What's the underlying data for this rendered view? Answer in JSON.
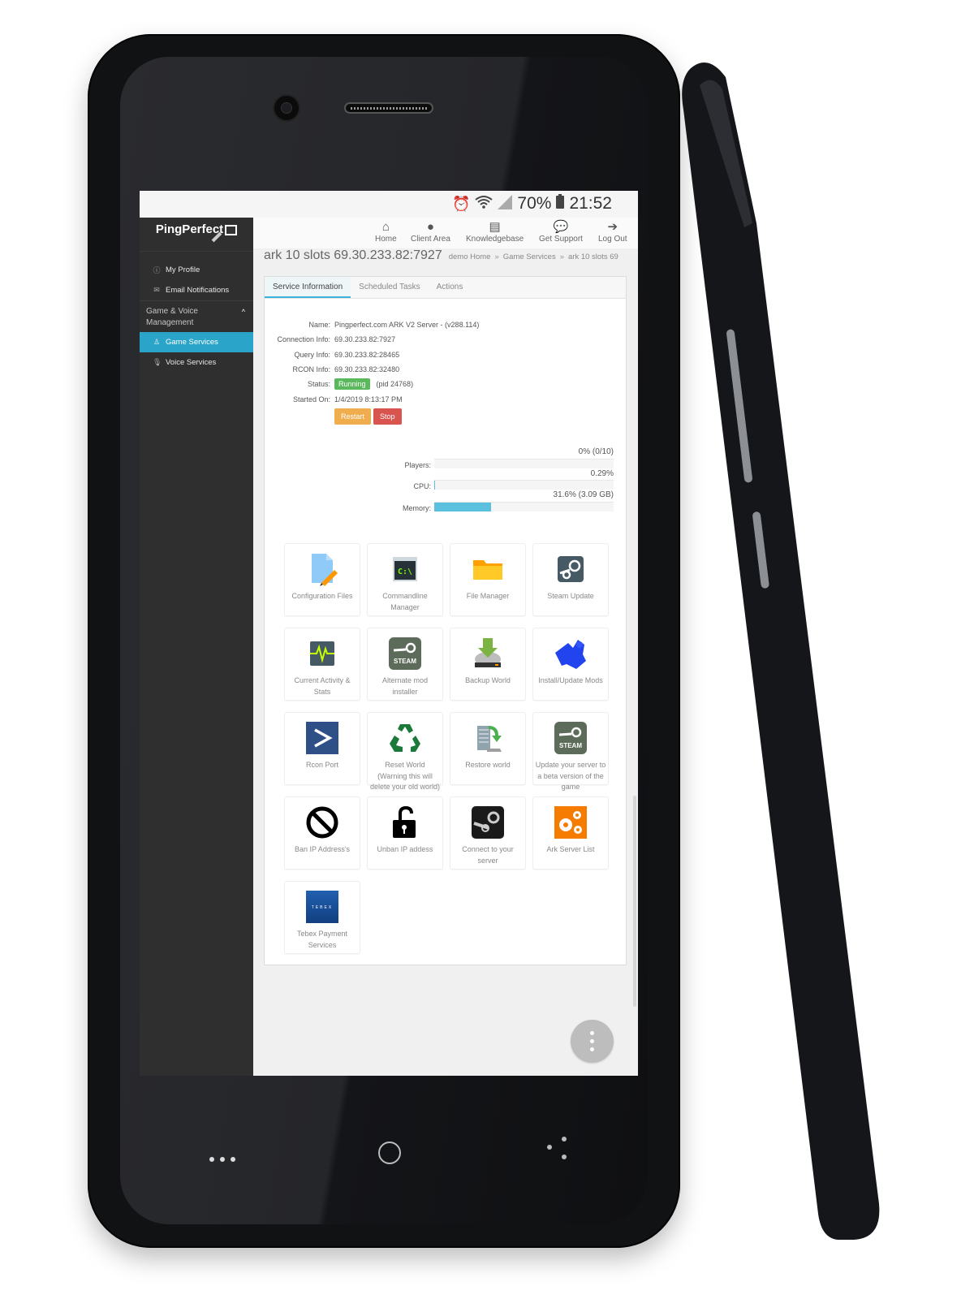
{
  "status_bar": {
    "icons": [
      "alarm-icon",
      "wifi-icon",
      "signal-icon",
      "battery-icon"
    ],
    "battery": "70%",
    "time": "21:52"
  },
  "sidebar": {
    "logo": "PingPerfect",
    "items": [
      {
        "label": "My Profile",
        "icon": "profile-icon"
      },
      {
        "label": "Email Notifications",
        "icon": "envelope-icon"
      }
    ],
    "group": {
      "label": "Game & Voice Management",
      "expanded": true
    },
    "group_items": [
      {
        "label": "Game Services",
        "icon": "joystick-icon",
        "active": true
      },
      {
        "label": "Voice Services",
        "icon": "microphone-icon",
        "active": false
      }
    ]
  },
  "topnav": [
    {
      "label": "Home",
      "icon": "home-icon"
    },
    {
      "label": "Client Area",
      "icon": "user-icon"
    },
    {
      "label": "Knowledgebase",
      "icon": "book-icon"
    },
    {
      "label": "Get Support",
      "icon": "chat-icon"
    },
    {
      "label": "Log Out",
      "icon": "logout-icon"
    }
  ],
  "page": {
    "title": "ark 10 slots 69.30.233.82:7927",
    "breadcrumb": [
      "demo Home",
      "Game Services",
      "ark 10 slots 69"
    ]
  },
  "tabs": [
    {
      "label": "Service Information",
      "active": true
    },
    {
      "label": "Scheduled Tasks",
      "active": false
    },
    {
      "label": "Actions",
      "active": false
    }
  ],
  "service": {
    "rows": [
      {
        "label": "Name:",
        "value": "Pingperfect.com ARK V2 Server - (v288.114)"
      },
      {
        "label": "Connection Info:",
        "value": "69.30.233.82:7927"
      },
      {
        "label": "Query Info:",
        "value": "69.30.233.82:28465"
      },
      {
        "label": "RCON Info:",
        "value": "69.30.233.82:32480"
      }
    ],
    "status_label": "Status:",
    "status": "Running",
    "pid": "(pid 24768)",
    "started_label": "Started On:",
    "started": "1/4/2019 8:13:17 PM",
    "restart_label": "Restart",
    "stop_label": "Stop",
    "colors": {
      "running": "#5cb85c",
      "restart": "#f0ad4e",
      "stop": "#d9534f",
      "accent": "#2aa4c8"
    }
  },
  "stats": [
    {
      "label": "Players:",
      "value_text": "0% (0/10)",
      "percent": 0
    },
    {
      "label": "CPU:",
      "value_text": "0.29%",
      "percent": 0.29
    },
    {
      "label": "Memory:",
      "value_text": "31.6% (3.09 GB)",
      "percent": 31.6
    }
  ],
  "tiles": [
    {
      "label": "Configuration Files",
      "icon": "config-file-icon"
    },
    {
      "label": "Commandline Manager",
      "icon": "terminal-icon"
    },
    {
      "label": "File Manager",
      "icon": "folder-icon"
    },
    {
      "label": "Steam Update",
      "icon": "steam-icon"
    },
    {
      "label": "Current Activity & Stats",
      "icon": "activity-icon"
    },
    {
      "label": "Alternate mod installer",
      "icon": "steam-badge-icon"
    },
    {
      "label": "Backup World",
      "icon": "backup-drive-icon"
    },
    {
      "label": "Install/Update Mods",
      "icon": "mods-puzzle-icon"
    },
    {
      "label": "Rcon Port",
      "icon": "powershell-icon"
    },
    {
      "label": "Reset World (Warning this will delete your old world)",
      "icon": "recycle-icon"
    },
    {
      "label": "Restore world",
      "icon": "restore-server-icon"
    },
    {
      "label": "Update your server to a beta version of the game",
      "icon": "steam-badge-icon"
    },
    {
      "label": "Ban IP Address's",
      "icon": "ban-icon"
    },
    {
      "label": "Unban IP addess",
      "icon": "unlock-icon"
    },
    {
      "label": "Connect to your server",
      "icon": "steam-connect-icon"
    },
    {
      "label": "Ark Server List",
      "icon": "gears-icon"
    },
    {
      "label": "Tebex Payment Services",
      "icon": "tebex-icon"
    }
  ],
  "tebex_text": "TEBEX",
  "steam_text": "STEAM",
  "terminal_text": "C:\\"
}
